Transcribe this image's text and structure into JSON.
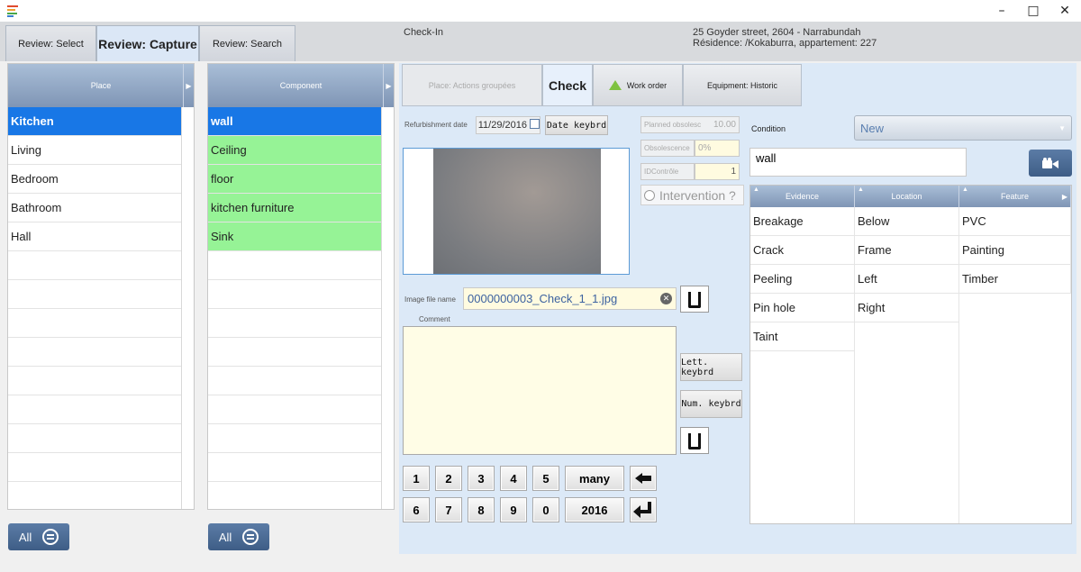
{
  "window": {
    "controls": {
      "minimize": "–",
      "maximize": "□",
      "close": "✕"
    }
  },
  "tabs": [
    {
      "label": "Review: Select"
    },
    {
      "label": "Review: Capture",
      "active": true
    },
    {
      "label": "Review: Search"
    }
  ],
  "header": {
    "title": "Check-In",
    "address_line1": "25 Goyder street, 2604 - Narrabundah",
    "address_line2": "Résidence: /Kokaburra, appartement: 227"
  },
  "place": {
    "header": "Place",
    "items": [
      {
        "label": "Kitchen",
        "selected": true
      },
      {
        "label": "Living"
      },
      {
        "label": "Bedroom"
      },
      {
        "label": "Bathroom"
      },
      {
        "label": "Hall"
      }
    ],
    "all_button": "All"
  },
  "component": {
    "header": "Component",
    "items": [
      {
        "label": "wall",
        "selected": true
      },
      {
        "label": "Ceiling"
      },
      {
        "label": "floor"
      },
      {
        "label": "kitchen furniture"
      },
      {
        "label": "Sink"
      }
    ],
    "all_button": "All"
  },
  "subtabs": [
    {
      "label": "Place: Actions groupées"
    },
    {
      "label": "Check"
    },
    {
      "label": "Work order"
    },
    {
      "label": "Equipment: Historic"
    }
  ],
  "form": {
    "refurbishment_label": "Refurbishment date",
    "refurbishment_value": "11/29/2016",
    "date_keyboard": "Date keybrd",
    "planned_obsolescence_label": "Planned obsolesc",
    "planned_obsolescence_value": "10.00",
    "obsolescence_label": "Obsolescence",
    "obsolescence_value": "0%",
    "idcontrole_label": "IDContrôle",
    "idcontrole_value": "1",
    "intervention_label": "Intervention ?",
    "image_file_label": "Image file name",
    "image_file_value": "0000000003_Check_1_1.jpg",
    "comment_label": "Comment",
    "letter_keyboard": "Lett. keybrd",
    "number_keyboard": "Num. keybrd"
  },
  "keypad": {
    "row1": [
      "1",
      "2",
      "3",
      "4",
      "5",
      "many"
    ],
    "row2": [
      "6",
      "7",
      "8",
      "9",
      "0",
      "2016"
    ]
  },
  "condition": {
    "label": "Condition",
    "value": "New",
    "component_name": "wall"
  },
  "grid": {
    "headers": [
      "Evidence",
      "Location",
      "Feature"
    ],
    "evidence": [
      "Breakage",
      "Crack",
      "Peeling",
      "Pin hole",
      "Taint"
    ],
    "location": [
      "Below",
      "Frame",
      "Left",
      "Right"
    ],
    "feature": [
      "PVC",
      "Painting",
      "Timber"
    ]
  }
}
